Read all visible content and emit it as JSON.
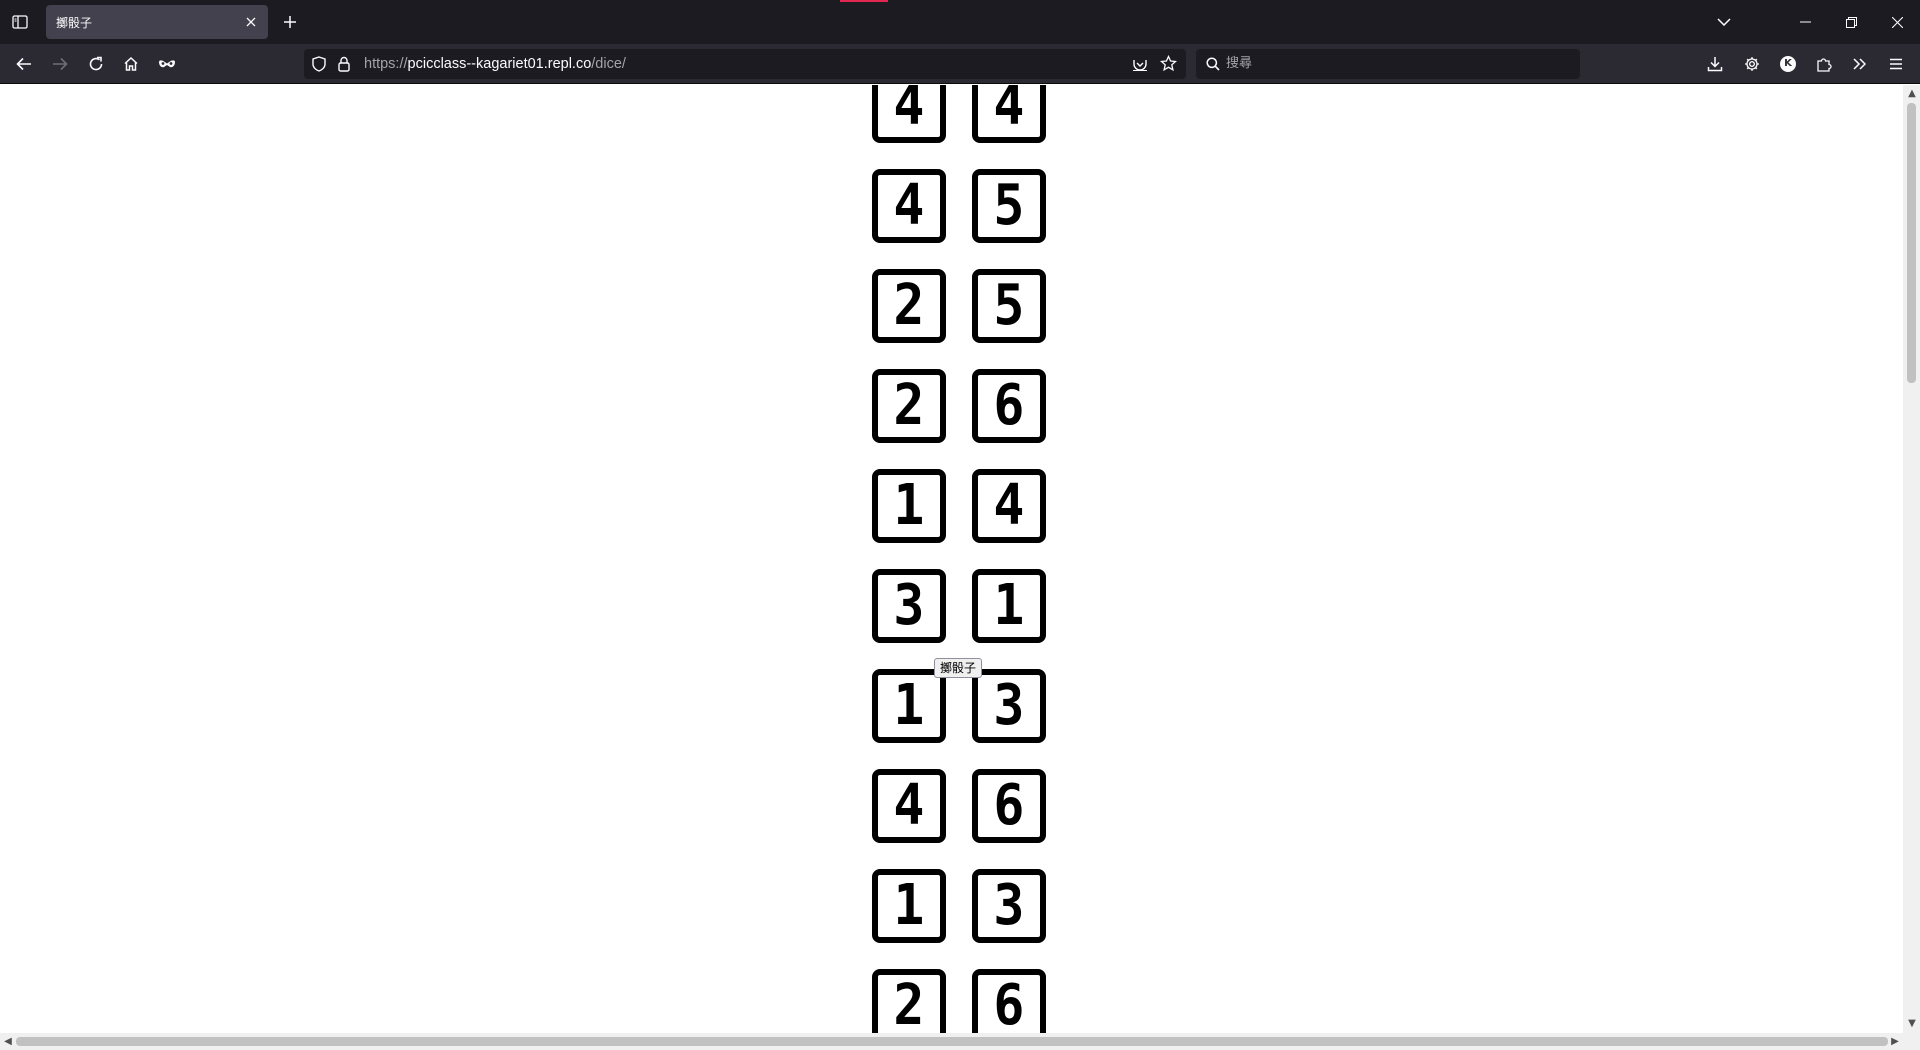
{
  "browser": {
    "tab_title": "擲骰子",
    "url_prefix": "https://",
    "url_domain": "pcicclass--kagariet01.repl.co",
    "url_path": "/dice/",
    "search_placeholder": "搜尋",
    "account_initial": "K"
  },
  "page": {
    "roll_button_label": "擲骰子",
    "dice_pairs": [
      [
        "4",
        "4"
      ],
      [
        "4",
        "5"
      ],
      [
        "2",
        "5"
      ],
      [
        "2",
        "6"
      ],
      [
        "1",
        "4"
      ],
      [
        "3",
        "1"
      ],
      [
        "1",
        "3"
      ],
      [
        "4",
        "6"
      ],
      [
        "1",
        "3"
      ],
      [
        "2",
        "6"
      ]
    ]
  },
  "colors": {
    "tabbar_bg": "#1c1b22",
    "navbar_bg": "#2b2a33",
    "active_tab_bg": "#42414d",
    "accent": "#e22850",
    "die_border": "#000000"
  }
}
